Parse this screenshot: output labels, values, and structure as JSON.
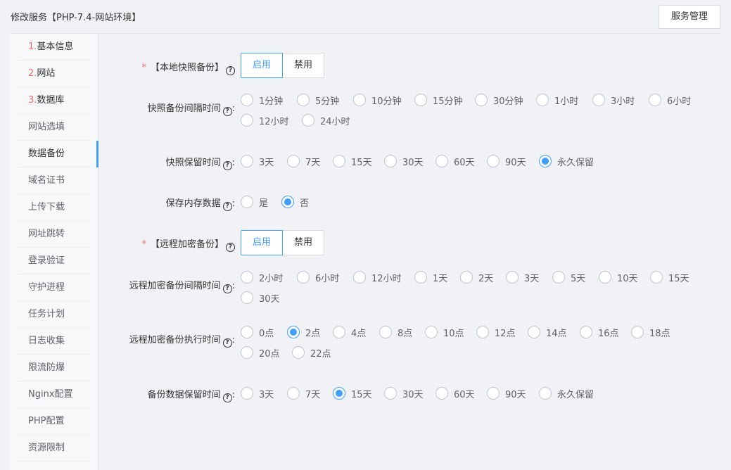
{
  "page_title": "修改服务【PHP-7.4-网站环境】",
  "service_button": "服务管理",
  "sidebar": [
    {
      "num": "1.",
      "label": "基本信息"
    },
    {
      "num": "2.",
      "label": "网站"
    },
    {
      "num": "3.",
      "label": "数据库"
    },
    {
      "num": "",
      "label": "网站选填"
    },
    {
      "num": "",
      "label": "数据备份"
    },
    {
      "num": "",
      "label": "域名证书"
    },
    {
      "num": "",
      "label": "上传下载"
    },
    {
      "num": "",
      "label": "网址跳转"
    },
    {
      "num": "",
      "label": "登录验证"
    },
    {
      "num": "",
      "label": "守护进程"
    },
    {
      "num": "",
      "label": "任务计划"
    },
    {
      "num": "",
      "label": "日志收集"
    },
    {
      "num": "",
      "label": "限流防爆"
    },
    {
      "num": "",
      "label": "Nginx配置"
    },
    {
      "num": "",
      "label": "PHP配置"
    },
    {
      "num": "",
      "label": "资源限制"
    }
  ],
  "active_sidebar_item": "数据备份",
  "form": {
    "local_snapshot": {
      "label": "【本地快照备份】",
      "enable": "启用",
      "disable": "禁用",
      "selected": "启用"
    },
    "snapshot_interval": {
      "label": "快照备份间隔时间",
      "options": [
        "1分钟",
        "5分钟",
        "10分钟",
        "15分钟",
        "30分钟",
        "1小时",
        "3小时",
        "6小时",
        "12小时",
        "24小时"
      ]
    },
    "snapshot_retention": {
      "label": "快照保留时间",
      "options": [
        "3天",
        "7天",
        "15天",
        "30天",
        "60天",
        "90天",
        "永久保留"
      ],
      "selected": "永久保留"
    },
    "save_memory": {
      "label": "保存内存数据",
      "options": [
        "是",
        "否"
      ],
      "selected": "否"
    },
    "remote_backup": {
      "label": "【远程加密备份】",
      "enable": "启用",
      "disable": "禁用",
      "selected": "启用"
    },
    "remote_interval": {
      "label": "远程加密备份间隔时间",
      "options": [
        "2小时",
        "6小时",
        "12小时",
        "1天",
        "2天",
        "3天",
        "5天",
        "10天",
        "15天",
        "30天"
      ]
    },
    "remote_exec_time": {
      "label": "远程加密备份执行时间",
      "options": [
        "0点",
        "2点",
        "4点",
        "8点",
        "10点",
        "12点",
        "14点",
        "16点",
        "18点",
        "20点",
        "22点"
      ],
      "selected": "2点"
    },
    "backup_retention": {
      "label": "备份数据保留时间",
      "options": [
        "3天",
        "7天",
        "15天",
        "30天",
        "60天",
        "90天",
        "永久保留"
      ],
      "selected": "15天"
    }
  },
  "colors": {
    "accent": "#409eff",
    "required": "#f56c6c",
    "background": "#f0f2f5"
  }
}
